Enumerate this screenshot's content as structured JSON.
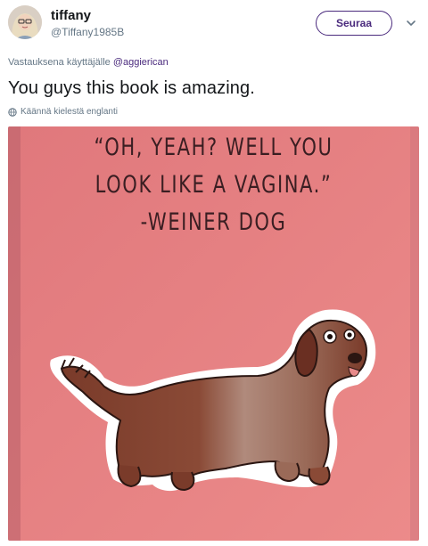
{
  "user": {
    "name": "tiffany",
    "handle": "@Tiffany1985B"
  },
  "header": {
    "follow_label": "Seuraa",
    "menu_icon": "chevron-down-icon"
  },
  "reply": {
    "prefix": "Vastauksena käyttäjälle",
    "mention": "@aggierican"
  },
  "tweet": {
    "text": "You guys this book is amazing.",
    "translate_label": "Käännä kielestä englanti",
    "translate_icon": "globe-icon"
  },
  "image": {
    "quote_lines": [
      "“OH, YEAH? WELL YOU",
      "LOOK LIKE A VAGINA.”",
      "-WEINER DOG"
    ]
  },
  "colors": {
    "accent": "#4a2a7d",
    "page_pink": "#e57b7e",
    "dog_brown": "#7a3b2a"
  }
}
